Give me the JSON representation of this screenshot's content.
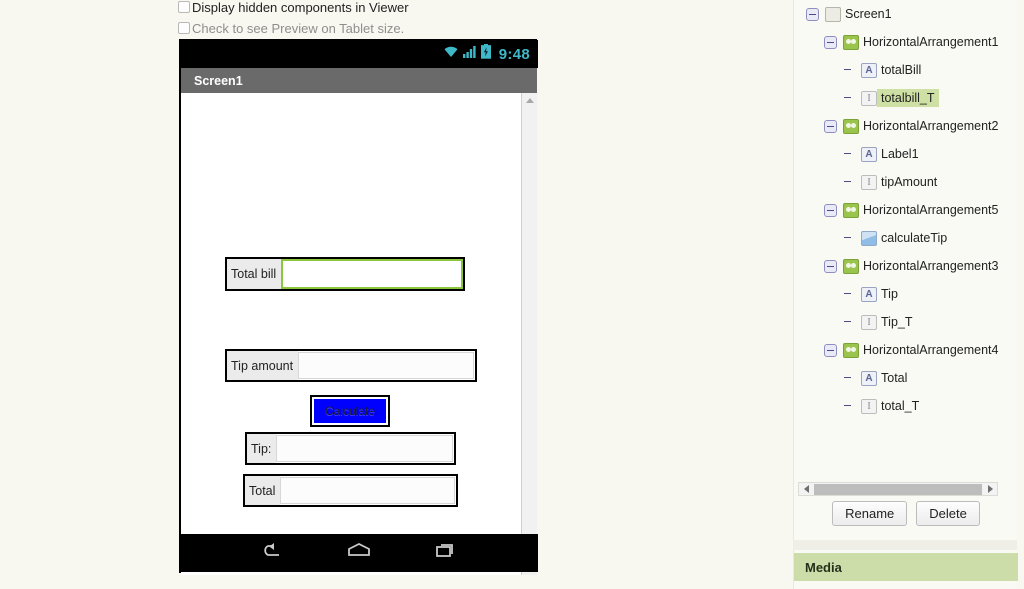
{
  "viewer": {
    "options": [
      {
        "label": "Display hidden components in Viewer",
        "checked": false,
        "dim": false
      },
      {
        "label": "Check to see Preview on Tablet size.",
        "checked": false,
        "dim": true
      }
    ]
  },
  "phone": {
    "status_bar": {
      "time": "9:48",
      "icons": [
        "wifi-icon",
        "signal-icon",
        "battery-icon"
      ],
      "accent": "#3fb8c8"
    },
    "title_bar": {
      "title": "Screen1",
      "background": "#6a6a6a"
    },
    "nav_bar": {
      "buttons": [
        "back-icon",
        "home-icon",
        "recents-icon"
      ]
    },
    "form": {
      "rows": [
        {
          "name": "HorizontalArrangement1",
          "label": "Total bill",
          "textbox_selected": true
        },
        {
          "name": "HorizontalArrangement2",
          "label": "Tip amount",
          "textbox_selected": false
        },
        {
          "name": "HorizontalArrangement3",
          "label": "Tip:",
          "textbox_selected": false
        },
        {
          "name": "HorizontalArrangement4",
          "label": "Total",
          "textbox_selected": false
        }
      ],
      "button": {
        "label": "Calculate",
        "color": "#0000ff"
      },
      "selection_color": "#8cc63e"
    }
  },
  "tree_panel": {
    "nodes": [
      {
        "label": "Screen1",
        "icon": "screen-icon",
        "indent": 0,
        "expander": true,
        "selected": false
      },
      {
        "label": "HorizontalArrangement1",
        "icon": "horizontal-arrangement-icon",
        "indent": 1,
        "expander": true,
        "selected": false
      },
      {
        "label": "totalBill",
        "icon": "label-icon",
        "indent": 2,
        "expander": false,
        "selected": false
      },
      {
        "label": "totalbill_T",
        "icon": "textbox-icon",
        "indent": 2,
        "expander": false,
        "selected": true
      },
      {
        "label": "HorizontalArrangement2",
        "icon": "horizontal-arrangement-icon",
        "indent": 1,
        "expander": true,
        "selected": false
      },
      {
        "label": "Label1",
        "icon": "label-icon",
        "indent": 2,
        "expander": false,
        "selected": false
      },
      {
        "label": "tipAmount",
        "icon": "textbox-icon",
        "indent": 2,
        "expander": false,
        "selected": false
      },
      {
        "label": "HorizontalArrangement5",
        "icon": "horizontal-arrangement-icon",
        "indent": 1,
        "expander": true,
        "selected": false
      },
      {
        "label": "calculateTip",
        "icon": "button-icon",
        "indent": 2,
        "expander": false,
        "selected": false
      },
      {
        "label": "HorizontalArrangement3",
        "icon": "horizontal-arrangement-icon",
        "indent": 1,
        "expander": true,
        "selected": false
      },
      {
        "label": "Tip",
        "icon": "label-icon",
        "indent": 2,
        "expander": false,
        "selected": false
      },
      {
        "label": "Tip_T",
        "icon": "textbox-icon",
        "indent": 2,
        "expander": false,
        "selected": false
      },
      {
        "label": "HorizontalArrangement4",
        "icon": "horizontal-arrangement-icon",
        "indent": 1,
        "expander": true,
        "selected": false
      },
      {
        "label": "Total",
        "icon": "label-icon",
        "indent": 2,
        "expander": false,
        "selected": false
      },
      {
        "label": "total_T",
        "icon": "textbox-icon",
        "indent": 2,
        "expander": false,
        "selected": false
      }
    ],
    "buttons": {
      "rename": "Rename",
      "delete": "Delete"
    },
    "selection_highlight": "#cfe0a4"
  },
  "media_panel": {
    "header": "Media",
    "header_color": "#cdddaa"
  }
}
